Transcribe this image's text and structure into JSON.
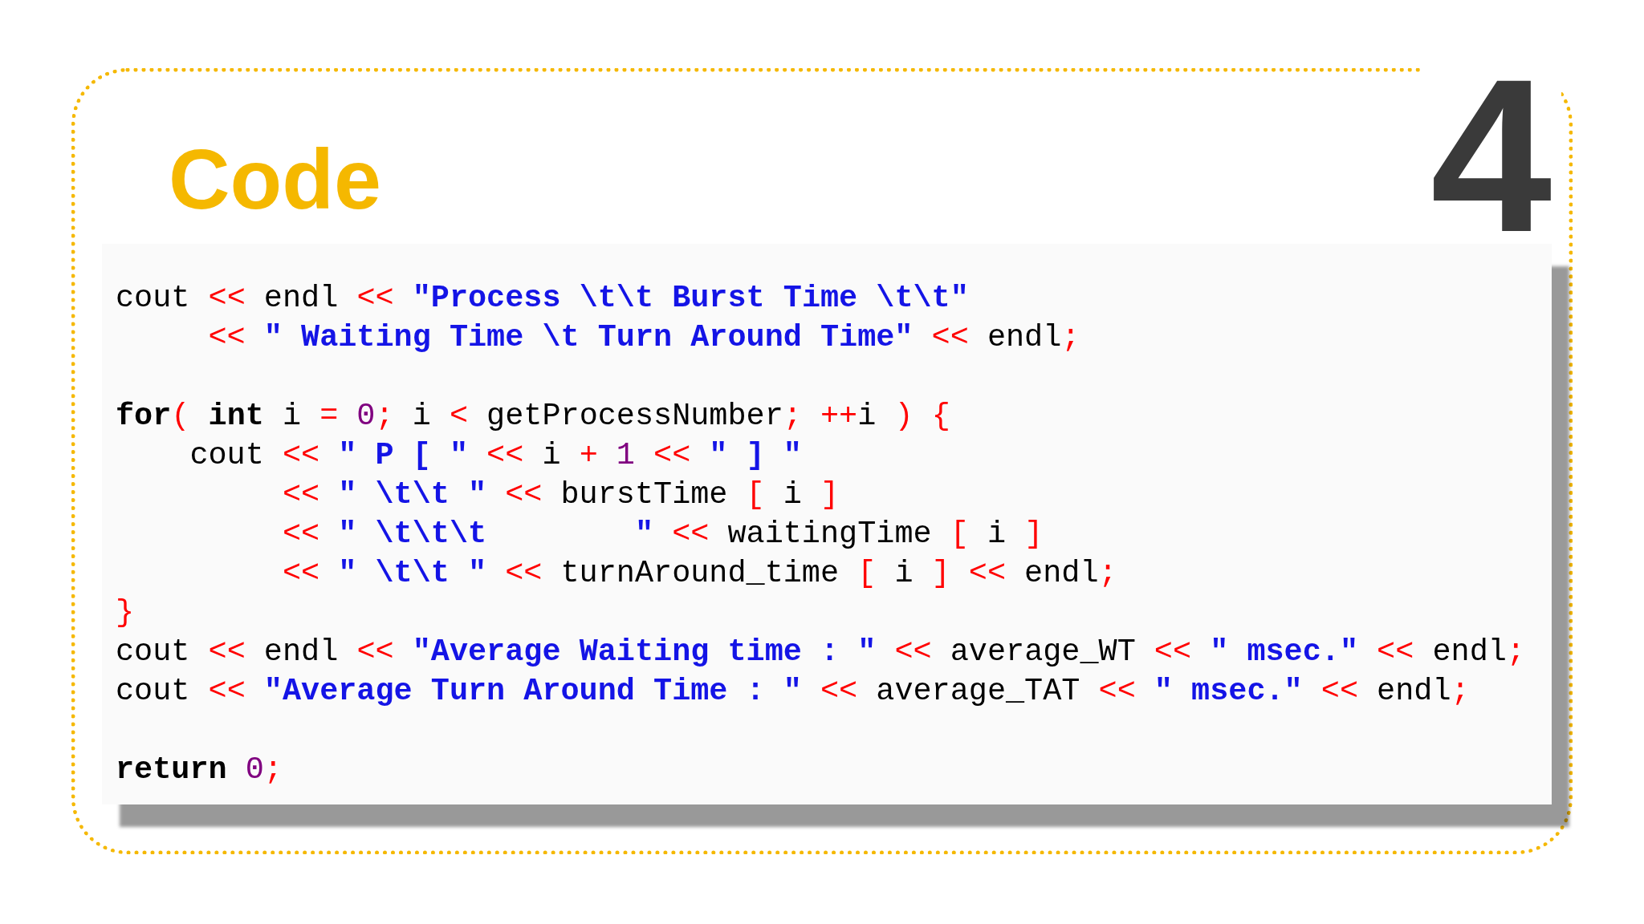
{
  "title": "Code",
  "number": "4",
  "code": {
    "blocks": [
      [
        {
          "tokens": [
            {
              "kind": "plain",
              "text": "cout "
            },
            {
              "kind": "op",
              "text": "<<"
            },
            {
              "kind": "plain",
              "text": " endl "
            },
            {
              "kind": "op",
              "text": "<<"
            },
            {
              "kind": "str",
              "text": " \"Process \\t\\t Burst Time \\t\\t\""
            }
          ]
        },
        {
          "tokens": [
            {
              "kind": "op",
              "text": "     <<"
            },
            {
              "kind": "str",
              "text": " \" Waiting Time \\t Turn Around Time\""
            },
            {
              "kind": "op",
              "text": " <<"
            },
            {
              "kind": "plain",
              "text": " endl"
            },
            {
              "kind": "op",
              "text": ";"
            }
          ]
        }
      ],
      [
        {
          "tokens": [
            {
              "kind": "kw",
              "text": "for"
            },
            {
              "kind": "op",
              "text": "("
            },
            {
              "kind": "kw",
              "text": " int"
            },
            {
              "kind": "plain",
              "text": " i "
            },
            {
              "kind": "op",
              "text": "="
            },
            {
              "kind": "num",
              "text": " 0"
            },
            {
              "kind": "op",
              "text": ";"
            },
            {
              "kind": "plain",
              "text": " i "
            },
            {
              "kind": "op",
              "text": "<"
            },
            {
              "kind": "plain",
              "text": " getProcessNumber"
            },
            {
              "kind": "op",
              "text": ";"
            },
            {
              "kind": "op",
              "text": " ++"
            },
            {
              "kind": "plain",
              "text": "i "
            },
            {
              "kind": "op",
              "text": ")"
            },
            {
              "kind": "op",
              "text": " {"
            }
          ]
        },
        {
          "tokens": [
            {
              "kind": "plain",
              "text": "    cout "
            },
            {
              "kind": "op",
              "text": "<<"
            },
            {
              "kind": "str",
              "text": " \" P [ \""
            },
            {
              "kind": "op",
              "text": " <<"
            },
            {
              "kind": "plain",
              "text": " i "
            },
            {
              "kind": "op",
              "text": "+"
            },
            {
              "kind": "num",
              "text": " 1"
            },
            {
              "kind": "op",
              "text": " <<"
            },
            {
              "kind": "str",
              "text": " \" ] \""
            }
          ]
        },
        {
          "tokens": [
            {
              "kind": "op",
              "text": "         <<"
            },
            {
              "kind": "str",
              "text": " \" \\t\\t \""
            },
            {
              "kind": "op",
              "text": " <<"
            },
            {
              "kind": "plain",
              "text": " burstTime "
            },
            {
              "kind": "op",
              "text": "["
            },
            {
              "kind": "plain",
              "text": " i "
            },
            {
              "kind": "op",
              "text": "]"
            }
          ]
        },
        {
          "tokens": [
            {
              "kind": "op",
              "text": "         <<"
            },
            {
              "kind": "str",
              "text": " \" \\t\\t\\t        \""
            },
            {
              "kind": "op",
              "text": " <<"
            },
            {
              "kind": "plain",
              "text": " waitingTime "
            },
            {
              "kind": "op",
              "text": "["
            },
            {
              "kind": "plain",
              "text": " i "
            },
            {
              "kind": "op",
              "text": "]"
            }
          ]
        },
        {
          "tokens": [
            {
              "kind": "op",
              "text": "         <<"
            },
            {
              "kind": "str",
              "text": " \" \\t\\t \""
            },
            {
              "kind": "op",
              "text": " <<"
            },
            {
              "kind": "plain",
              "text": " turnAround_time "
            },
            {
              "kind": "op",
              "text": "["
            },
            {
              "kind": "plain",
              "text": " i "
            },
            {
              "kind": "op",
              "text": "]"
            },
            {
              "kind": "op",
              "text": " <<"
            },
            {
              "kind": "plain",
              "text": " endl"
            },
            {
              "kind": "op",
              "text": ";"
            }
          ]
        },
        {
          "tokens": [
            {
              "kind": "op",
              "text": "}"
            }
          ]
        },
        {
          "tokens": [
            {
              "kind": "plain",
              "text": "cout "
            },
            {
              "kind": "op",
              "text": "<<"
            },
            {
              "kind": "plain",
              "text": " endl "
            },
            {
              "kind": "op",
              "text": "<<"
            },
            {
              "kind": "str",
              "text": " \"Average Waiting time : \""
            },
            {
              "kind": "op",
              "text": " <<"
            },
            {
              "kind": "plain",
              "text": " average_WT "
            },
            {
              "kind": "op",
              "text": "<<"
            },
            {
              "kind": "str",
              "text": " \" msec.\""
            },
            {
              "kind": "op",
              "text": " <<"
            },
            {
              "kind": "plain",
              "text": " endl"
            },
            {
              "kind": "op",
              "text": ";"
            }
          ]
        },
        {
          "tokens": [
            {
              "kind": "plain",
              "text": "cout "
            },
            {
              "kind": "op",
              "text": "<<"
            },
            {
              "kind": "str",
              "text": " \"Average Turn Around Time : \""
            },
            {
              "kind": "op",
              "text": " <<"
            },
            {
              "kind": "plain",
              "text": " average_TAT "
            },
            {
              "kind": "op",
              "text": "<<"
            },
            {
              "kind": "str",
              "text": " \" msec.\""
            },
            {
              "kind": "op",
              "text": " <<"
            },
            {
              "kind": "plain",
              "text": " endl"
            },
            {
              "kind": "op",
              "text": ";"
            }
          ]
        }
      ],
      [
        {
          "tokens": [
            {
              "kind": "kw",
              "text": "return"
            },
            {
              "kind": "num",
              "text": " 0"
            },
            {
              "kind": "op",
              "text": ";"
            }
          ]
        }
      ]
    ]
  }
}
